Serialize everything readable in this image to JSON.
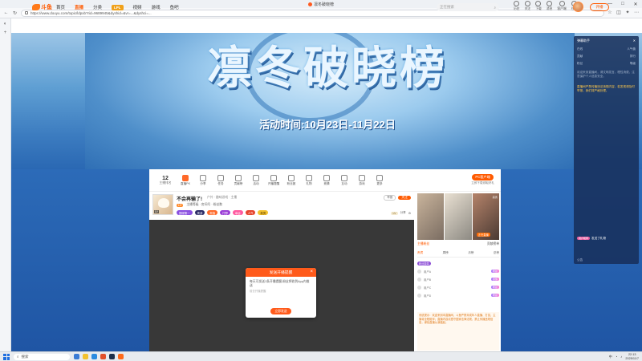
{
  "browser": {
    "tab_title": "凛冬破晓榜",
    "url": "https://www.douyu.com/topic/ldpxb?rid=9689945&dyshid=&vr=...&dyshci=...",
    "window_controls": [
      "—",
      "□",
      "✕"
    ]
  },
  "site": {
    "logo_text": "斗鱼",
    "nav": [
      "首页",
      "直播",
      "分类",
      "LPL",
      "视频",
      "游戏",
      "鱼吧"
    ],
    "search_placeholder": "正在搜索",
    "header_tools": [
      "历史",
      "关注",
      "下载",
      "消息",
      "客户端",
      "任务"
    ],
    "open_live_label": "开播"
  },
  "banner": {
    "title": "凛冬破晓榜",
    "date": "活动时间:10月23日-11月22日"
  },
  "room_toolbar": {
    "rank_number": "12",
    "rank_label": "主播排名",
    "tools": [
      "直播PK",
      "分享",
      "任务",
      "贡献榜",
      "活动",
      "开播提醒",
      "粉丝团",
      "礼物",
      "竞猜",
      "互动",
      "游戏",
      "更多"
    ],
    "pc_button": "PC客户端",
    "pc_sub": "立即下载领取好礼"
  },
  "streamer": {
    "title": "不会再输了!",
    "category": "户外 · 趣味游戏 · 主播",
    "level": "LV",
    "room_info": "主播等级 · 房间号 · 粉丝数",
    "report": "举报",
    "follow": "关注",
    "share": "分享",
    "tags": [
      "国服第一",
      "夜游",
      "颜值",
      "打野",
      "幸运",
      "人气",
      "新秀"
    ]
  },
  "modal": {
    "header": "发送开播提醒",
    "body": "每天可发送1条开播提醒,粉丝将收到App内推送",
    "note": "前去开播提醒",
    "button": "立即发送",
    "close": "×"
  },
  "right_panel": {
    "thumb_label": "正在直播",
    "thumb_hd": "高清",
    "tabs": [
      "主播粉丝",
      "贡献榜单"
    ],
    "subtabs": [
      "贵宾",
      "周榜",
      "月榜",
      "总榜"
    ],
    "chip": "粉丝徽章",
    "list": [
      {
        "name": "用户A",
        "badge": "粉丝"
      },
      {
        "name": "用户B",
        "badge": "贵族"
      },
      {
        "name": "用户C",
        "badge": "粉丝"
      },
      {
        "name": "用户D",
        "badge": "粉丝"
      }
    ],
    "notice": "系统提示：欢迎来到本直播间，斗鱼严禁未成年人直播、打赏，主播将全程陪伴；直播内容请遵守国家法律法规，禁止传播违规信息，绿色直播从我做起。"
  },
  "float_panel": {
    "title": "弹幕助手",
    "stats": [
      [
        "在线",
        "人气值"
      ],
      [
        "贡献",
        "排行"
      ],
      [
        "粉丝",
        "等级"
      ]
    ],
    "text": "欢迎来到直播间，请文明发言，理性消费，注意保护个人信息安全。",
    "warning": "直播间严禁传播违法违规内容，若发现请及时举报，我们将严格处理。",
    "chat": [
      "用户昵称",
      "发送了礼物"
    ],
    "footer": "公告"
  },
  "taskbar": {
    "search": "搜索",
    "tray_text": "中",
    "time": "22:13",
    "date": "2025/11/7"
  }
}
